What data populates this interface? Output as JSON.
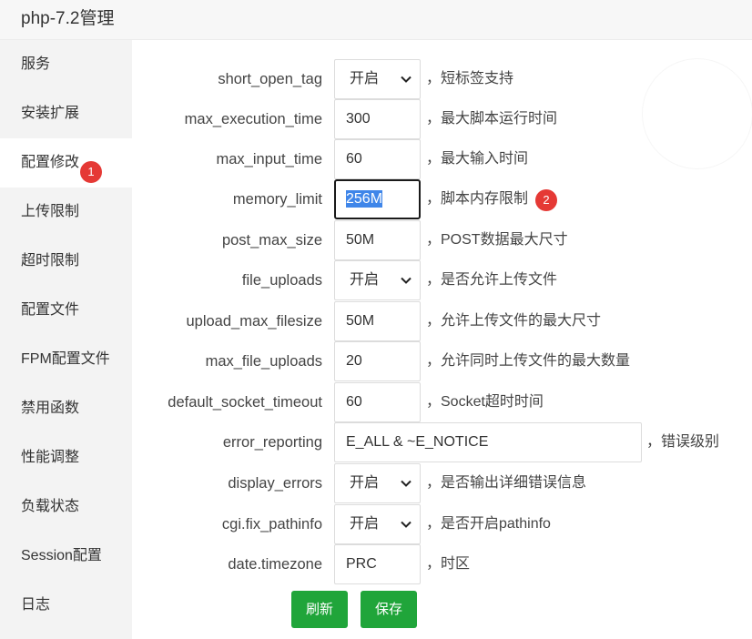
{
  "window": {
    "title": "php-7.2管理"
  },
  "sidebar": {
    "items": [
      {
        "label": "服务"
      },
      {
        "label": "安装扩展"
      },
      {
        "label": "配置修改",
        "active": true,
        "badge": "1"
      },
      {
        "label": "上传限制"
      },
      {
        "label": "超时限制"
      },
      {
        "label": "配置文件"
      },
      {
        "label": "FPM配置文件"
      },
      {
        "label": "禁用函数"
      },
      {
        "label": "性能调整"
      },
      {
        "label": "负载状态"
      },
      {
        "label": "Session配置"
      },
      {
        "label": "日志"
      }
    ]
  },
  "form": {
    "rows": [
      {
        "label": "short_open_tag",
        "value": "开启",
        "hint": "，短标签支持"
      },
      {
        "label": "max_execution_time",
        "value": "300",
        "hint": "，最大脚本运行时间"
      },
      {
        "label": "max_input_time",
        "value": "60",
        "hint": "，最大输入时间"
      },
      {
        "label": "memory_limit",
        "value": "256M",
        "hint": "，脚本内存限制",
        "badge": "2"
      },
      {
        "label": "post_max_size",
        "value": "50M",
        "hint": "，POST数据最大尺寸"
      },
      {
        "label": "file_uploads",
        "value": "开启",
        "hint": "，是否允许上传文件"
      },
      {
        "label": "upload_max_filesize",
        "value": "50M",
        "hint": "，允许上传文件的最大尺寸"
      },
      {
        "label": "max_file_uploads",
        "value": "20",
        "hint": "，允许同时上传文件的最大数量"
      },
      {
        "label": "default_socket_timeout",
        "value": "60",
        "hint": "，Socket超时时间"
      },
      {
        "label": "error_reporting",
        "value": "E_ALL & ~E_NOTICE",
        "hint": "，错误级别"
      },
      {
        "label": "display_errors",
        "value": "开启",
        "hint": "，是否输出详细错误信息"
      },
      {
        "label": "cgi.fix_pathinfo",
        "value": "开启",
        "hint": "，是否开启pathinfo"
      },
      {
        "label": "date.timezone",
        "value": "PRC",
        "hint": "，时区"
      }
    ]
  },
  "buttons": {
    "refresh": "刷新",
    "save": "保存"
  },
  "colors": {
    "accent": "#20a53a",
    "badge": "#e53935",
    "selection": "#3f86e9"
  },
  "icons": {
    "select_caret": "chevron-down-icon"
  }
}
